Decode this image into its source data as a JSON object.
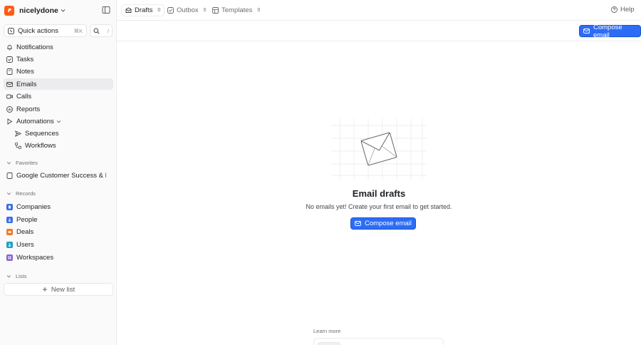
{
  "workspace": {
    "name": "nicelydone",
    "logo_color": "#ff5b14"
  },
  "quick_actions": {
    "label": "Quick actions",
    "shortcut": "⌘K",
    "search_shortcut": "/"
  },
  "nav": [
    {
      "label": "Notifications",
      "icon": "bell-icon"
    },
    {
      "label": "Tasks",
      "icon": "checkbox-icon"
    },
    {
      "label": "Notes",
      "icon": "note-icon"
    },
    {
      "label": "Emails",
      "icon": "mail-icon",
      "active": true
    },
    {
      "label": "Calls",
      "icon": "video-icon"
    },
    {
      "label": "Reports",
      "icon": "chart-icon"
    },
    {
      "label": "Automations",
      "icon": "play-icon"
    }
  ],
  "automations": [
    {
      "label": "Sequences",
      "icon": "send-icon"
    },
    {
      "label": "Workflows",
      "icon": "workflow-icon"
    }
  ],
  "favorites": {
    "title": "Favorites",
    "items": [
      {
        "label": "Google Customer Success & Partnerships",
        "icon": "document-icon"
      }
    ]
  },
  "records": {
    "title": "Records",
    "items": [
      {
        "label": "Companies",
        "color": "#3b6ee8"
      },
      {
        "label": "People",
        "color": "#3b6ee8"
      },
      {
        "label": "Deals",
        "color": "#f07a2b"
      },
      {
        "label": "Users",
        "color": "#1ea0c9"
      },
      {
        "label": "Workspaces",
        "color": "#8a63d2"
      }
    ]
  },
  "lists": {
    "title": "Lists",
    "new_list": "New list"
  },
  "tabs": [
    {
      "label": "Drafts",
      "count": "0",
      "active": true
    },
    {
      "label": "Outbox",
      "count": "0"
    },
    {
      "label": "Templates",
      "count": "0"
    }
  ],
  "help": "Help",
  "toolbar": {
    "compose": "Compose email"
  },
  "empty": {
    "title": "Email drafts",
    "subtitle": "No emails yet! Create your first email to get started.",
    "compose": "Compose email"
  },
  "learn_more": "Learn more",
  "colors": {
    "accent": "#2d6cf5",
    "sidebar_bg": "#fafafa",
    "active_item": "#ececee"
  }
}
